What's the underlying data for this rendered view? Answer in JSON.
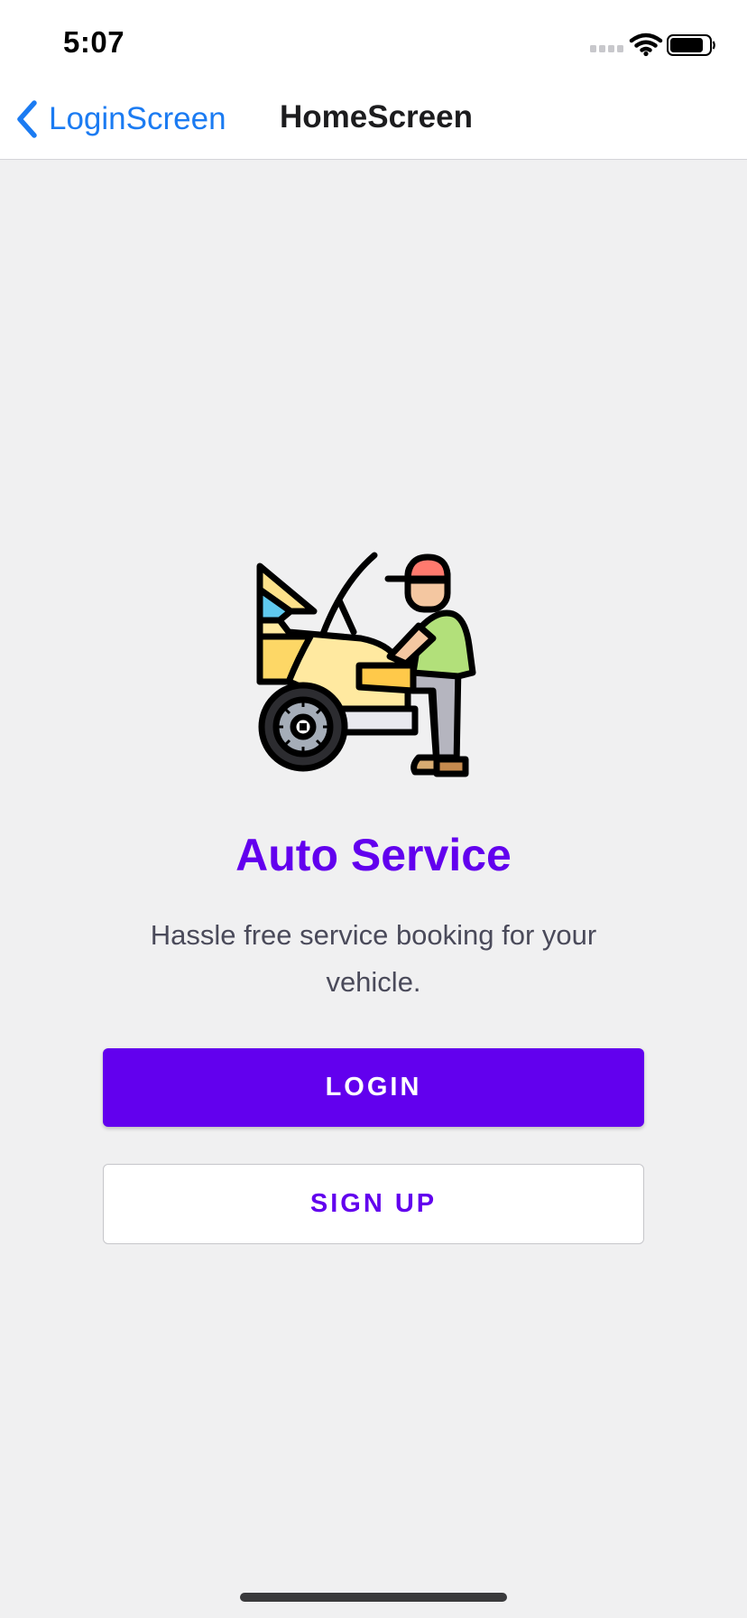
{
  "status_bar": {
    "time": "5:07"
  },
  "nav": {
    "back_label": "LoginScreen",
    "title": "HomeScreen"
  },
  "hero": {
    "title": "Auto Service",
    "tagline": "Hassle free service booking for your vehicle."
  },
  "buttons": {
    "login_label": "LOGIN",
    "signup_label": "SIGN UP"
  },
  "colors": {
    "accent": "#6200ee",
    "nav_link": "#1b7bf2",
    "background": "#f0f0f1"
  },
  "icons": {
    "back": "chevron-left-icon",
    "cellular": "cellular-signal-icon",
    "wifi": "wifi-icon",
    "battery": "battery-icon",
    "illustration": "car-mechanic-illustration"
  }
}
